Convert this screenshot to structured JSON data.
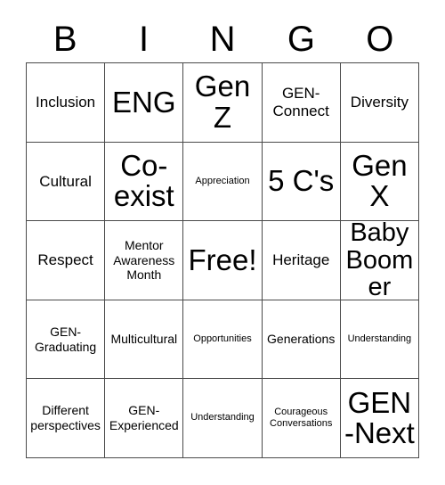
{
  "card": {
    "header_letters": [
      "B",
      "I",
      "N",
      "G",
      "O"
    ],
    "rows": [
      [
        {
          "text": "Inclusion",
          "size": "md"
        },
        {
          "text": "ENG",
          "size": "xl"
        },
        {
          "text": "Gen Z",
          "size": "xl"
        },
        {
          "text": "GEN-Connect",
          "size": "md"
        },
        {
          "text": "Diversity",
          "size": "md"
        }
      ],
      [
        {
          "text": "Cultural",
          "size": "md"
        },
        {
          "text": "Co-exist",
          "size": "xl"
        },
        {
          "text": "Appreciation",
          "size": "xs"
        },
        {
          "text": "5 C's",
          "size": "xl"
        },
        {
          "text": "Gen X",
          "size": "xl"
        }
      ],
      [
        {
          "text": "Respect",
          "size": "md"
        },
        {
          "text": "Mentor Awareness Month",
          "size": "sm"
        },
        {
          "text": "Free!",
          "size": "xl"
        },
        {
          "text": "Heritage",
          "size": "md"
        },
        {
          "text": "Baby Boomer",
          "size": "lg"
        }
      ],
      [
        {
          "text": "GEN-Graduating",
          "size": "sm"
        },
        {
          "text": "Multicultural",
          "size": "sm"
        },
        {
          "text": "Opportunities",
          "size": "xs"
        },
        {
          "text": "Generations",
          "size": "sm"
        },
        {
          "text": "Understanding",
          "size": "xs"
        }
      ],
      [
        {
          "text": "Different perspectives",
          "size": "sm"
        },
        {
          "text": "GEN-Experienced",
          "size": "sm"
        },
        {
          "text": "Understanding",
          "size": "xs"
        },
        {
          "text": "Courageous Conversations",
          "size": "xs"
        },
        {
          "text": "GEN-Next",
          "size": "xl"
        }
      ]
    ]
  },
  "colors": {
    "background": "#ffffff",
    "grid_line": "#4a4a4a",
    "text": "#000000"
  }
}
